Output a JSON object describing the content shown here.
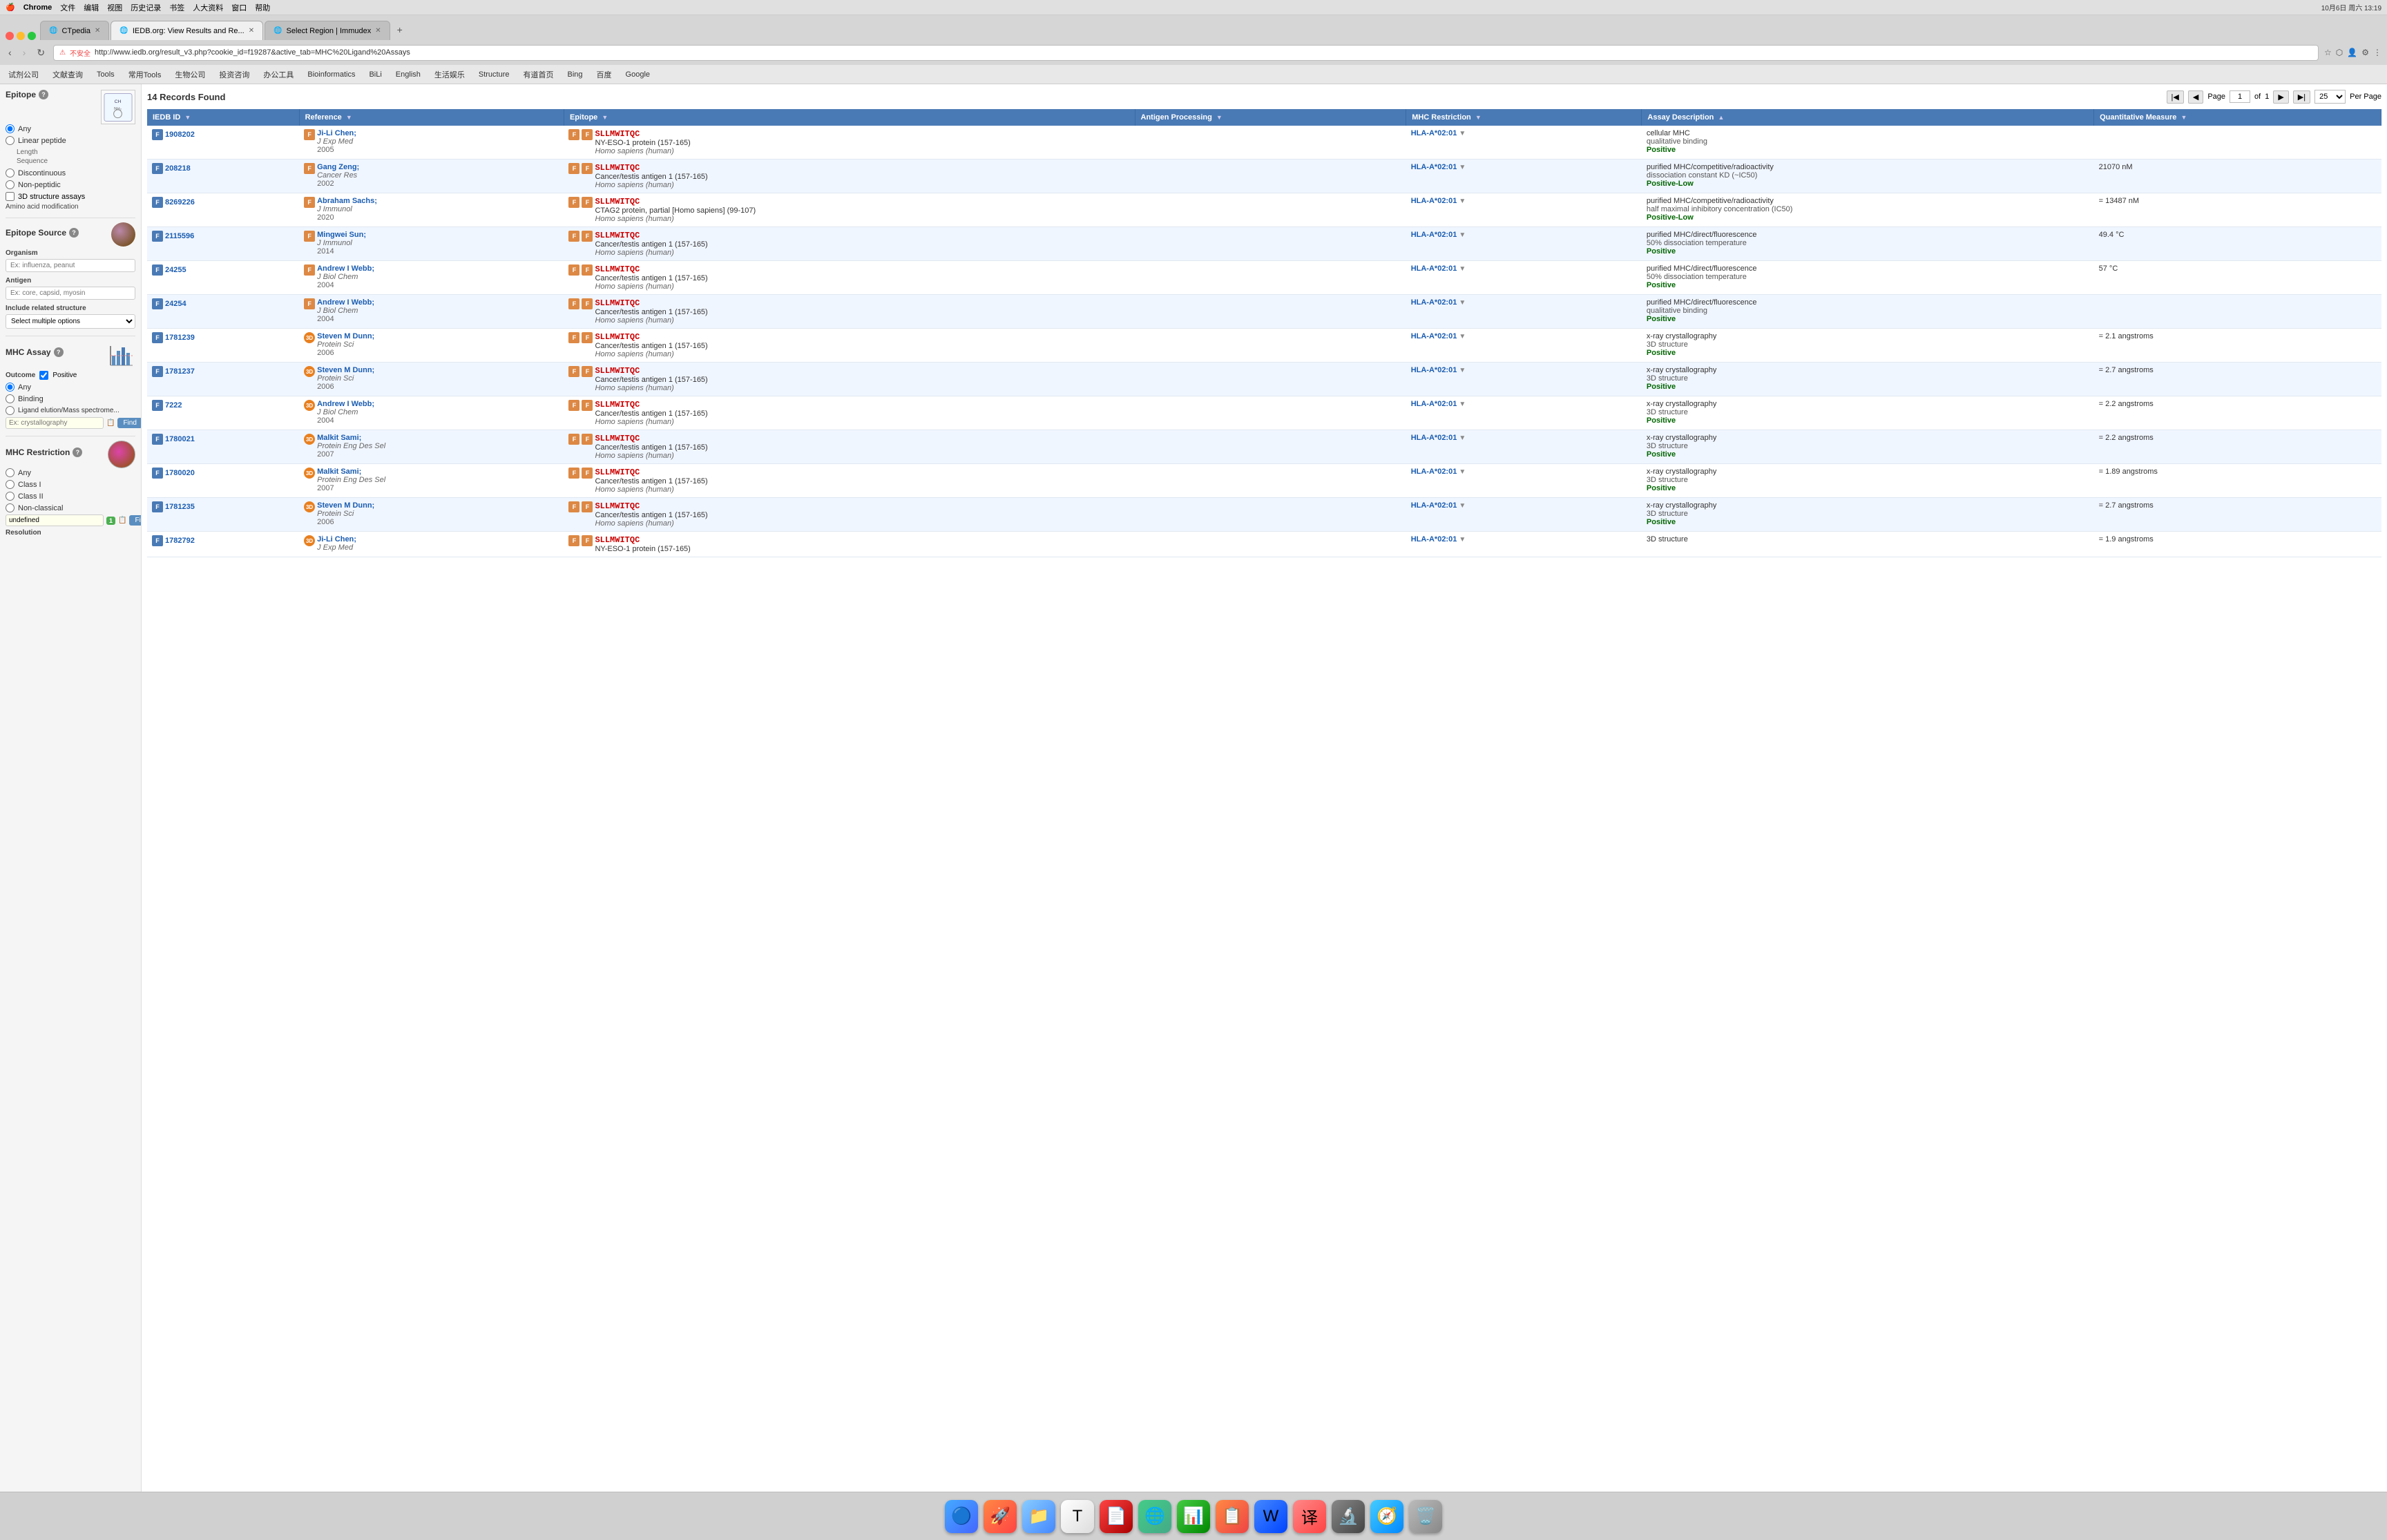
{
  "macos": {
    "topbar_items": [
      "Chrome",
      "文件",
      "编辑",
      "视图",
      "历史记录",
      "书签",
      "人大资料",
      "窗口",
      "帮助"
    ],
    "time": "10月6日 周六 13:19",
    "apple": "🍎"
  },
  "browser": {
    "tabs": [
      {
        "label": "CTpedia",
        "active": false,
        "id": "tab-ctpedia"
      },
      {
        "label": "IEDB.org: View Results and Re...",
        "active": true,
        "id": "tab-iedb"
      },
      {
        "label": "Select Region | Immudex",
        "active": false,
        "id": "tab-immudex"
      }
    ],
    "url": "http://www.iedb.org/result_v3.php?cookie_id=f19287&active_tab=MHC%20Ligand%20Assays",
    "url_insecure": "不安全",
    "bookmarks": [
      "试剂公司",
      "文献查询",
      "Tools",
      "常用Tools",
      "生物公司",
      "投资咨询",
      "办公工具",
      "Bioinformatics",
      "BiLi",
      "English",
      "生活娱乐",
      "Structure",
      "有道首页",
      "Bing",
      "百度",
      "Google"
    ]
  },
  "sidebar": {
    "epitope_title": "Epitope",
    "epitope_options": [
      "Any",
      "Linear peptide",
      "Discontinuous",
      "Non-peptidic"
    ],
    "epitope_sub": [
      "Length",
      "Sequence"
    ],
    "checkbox_3d": "3D structure assays",
    "amino_acid": "Amino acid modification",
    "source_title": "Epitope Source",
    "organism_label": "Organism",
    "organism_placeholder": "Ex: influenza, peanut",
    "antigen_label": "Antigen",
    "antigen_placeholder": "Ex: core, capsid, myosin",
    "related_structure": "Include related structure",
    "select_options": "Select multiple options",
    "mhc_assay_title": "MHC Assay",
    "outcome_label": "Outcome",
    "positive_label": "Positive",
    "assay_options": [
      "Any",
      "Binding",
      "Ligand elution/Mass spectrome..."
    ],
    "crystallography_placeholder": "Ex: crystallography",
    "find_label": "Find",
    "mhc_restriction_title": "MHC Restriction",
    "mhc_options": [
      "Any",
      "Class I",
      "Class II",
      "Non-classical"
    ],
    "undefined_label": "undefined",
    "undefined_badge": "1",
    "resolution_label": "Resolution"
  },
  "main": {
    "records_found": "14 Records Found",
    "page_label": "Page",
    "page_current": "1",
    "page_of": "of",
    "page_total": "1",
    "per_page": "25",
    "per_page_label": "Per Page",
    "columns": [
      "IEDB ID",
      "Reference",
      "Epitope",
      "Antigen Processing",
      "MHC Restriction",
      "Assay Description",
      "Quantitative Measure"
    ],
    "rows": [
      {
        "id": "1908202",
        "ref_name": "Ji-Li Chen;",
        "ref_journal": "J Exp Med",
        "ref_year": "2005",
        "epitope_seq": "SLLMWITQC",
        "epitope_name": "NY-ESO-1 protein (157-165)",
        "epitope_species": "Homo sapiens (human)",
        "mhc": "HLA-A*02:01",
        "assay_type": "cellular MHC",
        "assay_method": "qualitative binding",
        "assay_result": "Positive",
        "quant": "",
        "has_3d": false
      },
      {
        "id": "208218",
        "ref_name": "Gang Zeng;",
        "ref_journal": "Cancer Res",
        "ref_year": "2002",
        "epitope_seq": "SLLMWITQC",
        "epitope_name": "Cancer/testis antigen 1 (157-165)",
        "epitope_species": "Homo sapiens (human)",
        "mhc": "HLA-A*02:01",
        "assay_type": "purified MHC/competitive/radioactivity",
        "assay_method": "dissociation constant KD (~IC50)",
        "assay_result": "Positive-Low",
        "quant": "21070 nM",
        "has_3d": false
      },
      {
        "id": "8269226",
        "ref_name": "Abraham Sachs;",
        "ref_journal": "J Immunol",
        "ref_year": "2020",
        "epitope_seq": "SLLMWITQC",
        "epitope_name": "CTAG2 protein, partial [Homo sapiens] (99-107)",
        "epitope_species": "Homo sapiens (human)",
        "mhc": "HLA-A*02:01",
        "assay_type": "purified MHC/competitive/radioactivity",
        "assay_method": "half maximal inhibitory concentration (IC50)",
        "assay_result": "Positive-Low",
        "quant": "= 13487 nM",
        "has_3d": false
      },
      {
        "id": "2115596",
        "ref_name": "Mingwei Sun;",
        "ref_journal": "J Immunol",
        "ref_year": "2014",
        "epitope_seq": "SLLMWITQC",
        "epitope_name": "Cancer/testis antigen 1 (157-165)",
        "epitope_species": "Homo sapiens (human)",
        "mhc": "HLA-A*02:01",
        "assay_type": "purified MHC/direct/fluorescence",
        "assay_method": "50% dissociation temperature",
        "assay_result": "Positive",
        "quant": "49.4 °C",
        "has_3d": false
      },
      {
        "id": "24255",
        "ref_name": "Andrew I Webb;",
        "ref_journal": "J Biol Chem",
        "ref_year": "2004",
        "epitope_seq": "SLLMWITQC",
        "epitope_name": "Cancer/testis antigen 1 (157-165)",
        "epitope_species": "Homo sapiens (human)",
        "mhc": "HLA-A*02:01",
        "assay_type": "purified MHC/direct/fluorescence",
        "assay_method": "50% dissociation temperature",
        "assay_result": "Positive",
        "quant": "57 °C",
        "has_3d": false
      },
      {
        "id": "24254",
        "ref_name": "Andrew I Webb;",
        "ref_journal": "J Biol Chem",
        "ref_year": "2004",
        "epitope_seq": "SLLMWITQC",
        "epitope_name": "Cancer/testis antigen 1 (157-165)",
        "epitope_species": "Homo sapiens (human)",
        "mhc": "HLA-A*02:01",
        "assay_type": "purified MHC/direct/fluorescence",
        "assay_method": "qualitative binding",
        "assay_result": "Positive",
        "quant": "",
        "has_3d": false
      },
      {
        "id": "1781239",
        "ref_name": "Steven M Dunn;",
        "ref_journal": "Protein Sci",
        "ref_year": "2006",
        "epitope_seq": "SLLMWITQC",
        "epitope_name": "Cancer/testis antigen 1 (157-165)",
        "epitope_species": "Homo sapiens (human)",
        "mhc": "HLA-A*02:01",
        "assay_type": "x-ray crystallography",
        "assay_method": "3D structure",
        "assay_result": "Positive",
        "quant": "= 2.1 angstroms",
        "has_3d": true
      },
      {
        "id": "1781237",
        "ref_name": "Steven M Dunn;",
        "ref_journal": "Protein Sci",
        "ref_year": "2006",
        "epitope_seq": "SLLMWITQC",
        "epitope_name": "Cancer/testis antigen 1 (157-165)",
        "epitope_species": "Homo sapiens (human)",
        "mhc": "HLA-A*02:01",
        "assay_type": "x-ray crystallography",
        "assay_method": "3D structure",
        "assay_result": "Positive",
        "quant": "= 2.7 angstroms",
        "has_3d": true
      },
      {
        "id": "7222",
        "ref_name": "Andrew I Webb;",
        "ref_journal": "J Biol Chem",
        "ref_year": "2004",
        "epitope_seq": "SLLMWITQC",
        "epitope_name": "Cancer/testis antigen 1 (157-165)",
        "epitope_species": "Homo sapiens (human)",
        "mhc": "HLA-A*02:01",
        "assay_type": "x-ray crystallography",
        "assay_method": "3D structure",
        "assay_result": "Positive",
        "quant": "= 2.2 angstroms",
        "has_3d": true
      },
      {
        "id": "1780021",
        "ref_name": "Malkit Sami;",
        "ref_journal": "Protein Eng Des Sel",
        "ref_year": "2007",
        "epitope_seq": "SLLMWITQC",
        "epitope_name": "Cancer/testis antigen 1 (157-165)",
        "epitope_species": "Homo sapiens (human)",
        "mhc": "HLA-A*02:01",
        "assay_type": "x-ray crystallography",
        "assay_method": "3D structure",
        "assay_result": "Positive",
        "quant": "= 2.2 angstroms",
        "has_3d": true
      },
      {
        "id": "1780020",
        "ref_name": "Malkit Sami;",
        "ref_journal": "Protein Eng Des Sel",
        "ref_year": "2007",
        "epitope_seq": "SLLMWITQC",
        "epitope_name": "Cancer/testis antigen 1 (157-165)",
        "epitope_species": "Homo sapiens (human)",
        "mhc": "HLA-A*02:01",
        "assay_type": "x-ray crystallography",
        "assay_method": "3D structure",
        "assay_result": "Positive",
        "quant": "= 1.89 angstroms",
        "has_3d": true
      },
      {
        "id": "1781235",
        "ref_name": "Steven M Dunn;",
        "ref_journal": "Protein Sci",
        "ref_year": "2006",
        "epitope_seq": "SLLMWITQC",
        "epitope_name": "Cancer/testis antigen 1 (157-165)",
        "epitope_species": "Homo sapiens (human)",
        "mhc": "HLA-A*02:01",
        "assay_type": "x-ray crystallography",
        "assay_method": "3D structure",
        "assay_result": "Positive",
        "quant": "= 2.7 angstroms",
        "has_3d": true
      },
      {
        "id": "1782792",
        "ref_name": "Ji-Li Chen;",
        "ref_journal": "J Exp Med",
        "ref_year": "",
        "epitope_seq": "SLLMWITQC",
        "epitope_name": "NY-ESO-1 protein (157-165)",
        "epitope_species": "",
        "mhc": "HLA-A*02:01",
        "assay_type": "3D structure",
        "assay_method": "",
        "assay_result": "",
        "quant": "= 1.9 angstroms",
        "has_3d": true
      }
    ]
  }
}
